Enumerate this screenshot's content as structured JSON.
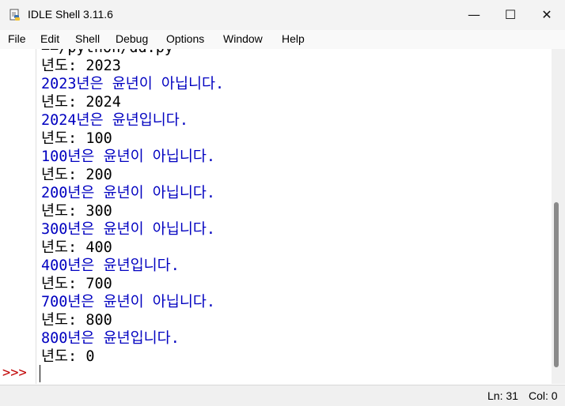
{
  "window": {
    "title": "IDLE Shell 3.11.6",
    "minimize_glyph": "—",
    "maximize_glyph": "☐",
    "close_glyph": "✕"
  },
  "menu": {
    "items": [
      "File",
      "Edit",
      "Shell",
      "Debug",
      "Options",
      "Window",
      "Help"
    ]
  },
  "shell": {
    "prompt_symbol": ">>>",
    "partial_line": "==/python/dd.py",
    "lines": [
      {
        "kind": "prompt",
        "text": "년도: 2023"
      },
      {
        "kind": "output",
        "text": "2023년은 윤년이 아닙니다."
      },
      {
        "kind": "prompt",
        "text": "년도: 2024"
      },
      {
        "kind": "output",
        "text": "2024년은 윤년입니다."
      },
      {
        "kind": "prompt",
        "text": "년도: 100"
      },
      {
        "kind": "output",
        "text": "100년은 윤년이 아닙니다."
      },
      {
        "kind": "prompt",
        "text": "년도: 200"
      },
      {
        "kind": "output",
        "text": "200년은 윤년이 아닙니다."
      },
      {
        "kind": "prompt",
        "text": "년도: 300"
      },
      {
        "kind": "output",
        "text": "300년은 윤년이 아닙니다."
      },
      {
        "kind": "prompt",
        "text": "년도: 400"
      },
      {
        "kind": "output",
        "text": "400년은 윤년입니다."
      },
      {
        "kind": "prompt",
        "text": "년도: 700"
      },
      {
        "kind": "output",
        "text": "700년은 윤년이 아닙니다."
      },
      {
        "kind": "prompt",
        "text": "년도: 800"
      },
      {
        "kind": "output",
        "text": "800년은 윤년입니다."
      },
      {
        "kind": "prompt",
        "text": "년도: 0"
      }
    ]
  },
  "status": {
    "line": "Ln: 31",
    "col": "Col: 0"
  },
  "colors": {
    "output_text": "#0000c0",
    "prompt_text": "#000000",
    "ps1": "#c00000"
  }
}
